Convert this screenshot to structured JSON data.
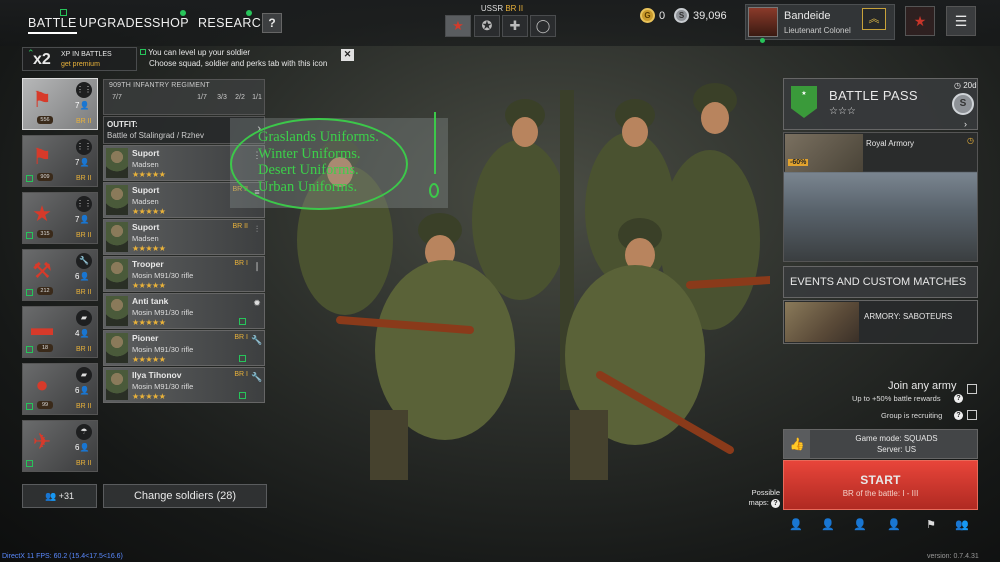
{
  "nav": {
    "tabs": [
      {
        "label": "BATTLE"
      },
      {
        "label": "UPGRADES"
      },
      {
        "label": "SHOP"
      },
      {
        "label": "RESEARCH"
      }
    ],
    "help_label": "?"
  },
  "nation": {
    "name": "USSR",
    "br": "BR II"
  },
  "currency": {
    "gold": "0",
    "silver": "39,096"
  },
  "player": {
    "name": "Bandeide",
    "rank": "Lieutenant Colonel"
  },
  "premium": {
    "multiplier": "x2",
    "line1": "XP IN BATTLES",
    "line2": "get premium"
  },
  "hint": {
    "line1": "You can level up your soldier",
    "line2": "Choose squad, soldier and perks tab with this icon"
  },
  "squads": [
    {
      "count": "7",
      "badge": "556",
      "br": "BR II",
      "selected": true
    },
    {
      "count": "7",
      "badge": "909",
      "br": "BR II"
    },
    {
      "count": "7",
      "badge": "315",
      "br": "BR II"
    },
    {
      "count": "6",
      "badge": "212",
      "br": "BR II"
    },
    {
      "count": "4",
      "badge": "18",
      "br": "BR II"
    },
    {
      "count": "6",
      "badge": "99",
      "br": "BR II"
    },
    {
      "count": "6",
      "badge": "",
      "br": "BR II"
    }
  ],
  "regiment": {
    "title": "909TH INFANTRY REGIMENT",
    "stats": [
      "7/7",
      "1/7",
      "3/3",
      "2/2",
      "1/1"
    ]
  },
  "outfit": {
    "label": "OUTFIT:",
    "value": "Battle of Stalingrad / Rzhev"
  },
  "soldiers": [
    {
      "name": "Suport",
      "weapon": "Madsen",
      "br": "",
      "stars": "★★★★★"
    },
    {
      "name": "Suport",
      "weapon": "Madsen",
      "br": "BR II",
      "stars": "★★★★★"
    },
    {
      "name": "Suport",
      "weapon": "Madsen",
      "br": "BR II",
      "stars": "★★★★★"
    },
    {
      "name": "Trooper",
      "weapon": "Mosin M91/30 rifle",
      "br": "BR I",
      "stars": "★★★★★"
    },
    {
      "name": "Anti tank",
      "weapon": "Mosin M91/30 rifle",
      "br": "BR I",
      "stars": "★★★★★"
    },
    {
      "name": "Pioner",
      "weapon": "Mosin M91/30 rifle",
      "br": "BR I",
      "stars": "★★★★★"
    },
    {
      "name": "Ilya Tihonov",
      "weapon": "Mosin M91/30 rifle",
      "br": "BR I",
      "stars": "★★★★★"
    }
  ],
  "recruit": {
    "label": "+31"
  },
  "change_soldiers": {
    "label": "Change soldiers (28)"
  },
  "annotation": {
    "lines": [
      "Graslands Uniforms.",
      "Winter Uniforms.",
      "Desert Uniforms.",
      "Urban Uniforms."
    ]
  },
  "battle_pass": {
    "title": "BATTLE PASS",
    "stars": "☆☆☆",
    "days": "20d",
    "coin": "S"
  },
  "armory": {
    "title": "Royal Armory",
    "discount": "-60%"
  },
  "events": {
    "label": "EVENTS AND CUSTOM MATCHES"
  },
  "saboteurs": {
    "label": "ARMORY: SABOTEURS"
  },
  "join": {
    "title": "Join any army",
    "reward": "Up to +50% battle rewards",
    "recruiting": "Group is recruiting"
  },
  "mode": {
    "game_mode": "Game mode: SQUADS",
    "server": "Server: US"
  },
  "start": {
    "label": "START",
    "sub": "BR of the battle: I - III"
  },
  "possible_maps": {
    "label": "Possible maps:"
  },
  "footer": {
    "fps": "DirectX 11 FPS: 60.2 (15.4<17.5<16.6)",
    "version": "version: 0.7.4.31"
  },
  "colors": {
    "accent_gold": "#e9b23a",
    "start_red": "#c8352a",
    "green_marker": "#27c45a",
    "annotation_green": "#3cd04a"
  }
}
